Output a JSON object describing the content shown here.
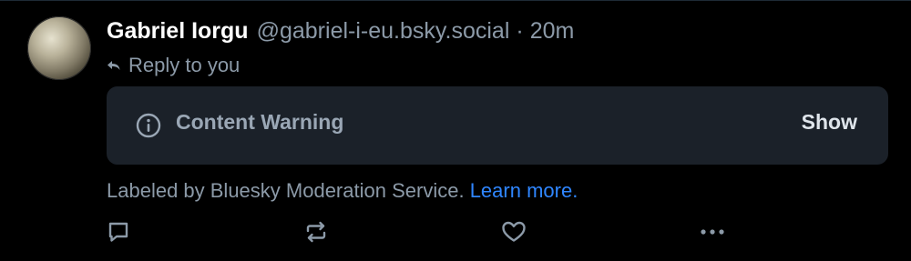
{
  "post": {
    "author_name": "Gabriel Iorgu",
    "handle": "@gabriel-i-eu.bsky.social",
    "separator": "·",
    "timestamp": "20m",
    "reply_context": "Reply to you",
    "content_warning": {
      "label": "Content Warning",
      "show_label": "Show",
      "icon": "info-circle-icon"
    },
    "moderation": {
      "text": "Labeled by Bluesky Moderation Service.",
      "link": "Learn more."
    },
    "actions": [
      {
        "name": "reply",
        "icon": "comment-icon"
      },
      {
        "name": "repost",
        "icon": "repost-icon"
      },
      {
        "name": "like",
        "icon": "heart-icon"
      },
      {
        "name": "more",
        "icon": "ellipsis-icon"
      }
    ]
  },
  "colors": {
    "background": "#000000",
    "muted_text": "#8c9aa8",
    "card_background": "#1b2129",
    "link": "#2f86ff"
  }
}
